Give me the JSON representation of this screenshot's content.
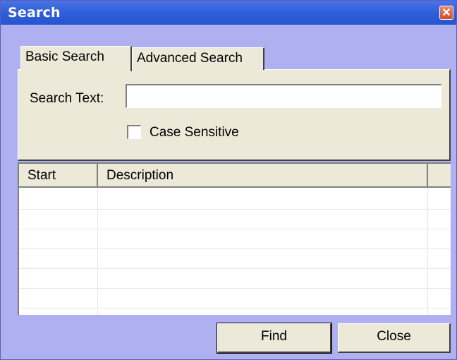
{
  "window": {
    "title": "Search",
    "close_glyph": "✕"
  },
  "tabs": [
    {
      "label": "Basic Search",
      "active": true
    },
    {
      "label": "Advanced Search",
      "active": false
    }
  ],
  "basic_search": {
    "search_text_label": "Search Text:",
    "search_text_value": "",
    "case_sensitive_label": "Case Sensitive",
    "case_sensitive_checked": false
  },
  "results_table": {
    "columns": [
      "Start",
      "Description"
    ],
    "rows": []
  },
  "buttons": {
    "find_label": "Find",
    "close_label": "Close"
  },
  "colors": {
    "titlebar": "#2f5fd8",
    "window_background": "#aeb0f0",
    "control_face": "#ece9d8"
  }
}
